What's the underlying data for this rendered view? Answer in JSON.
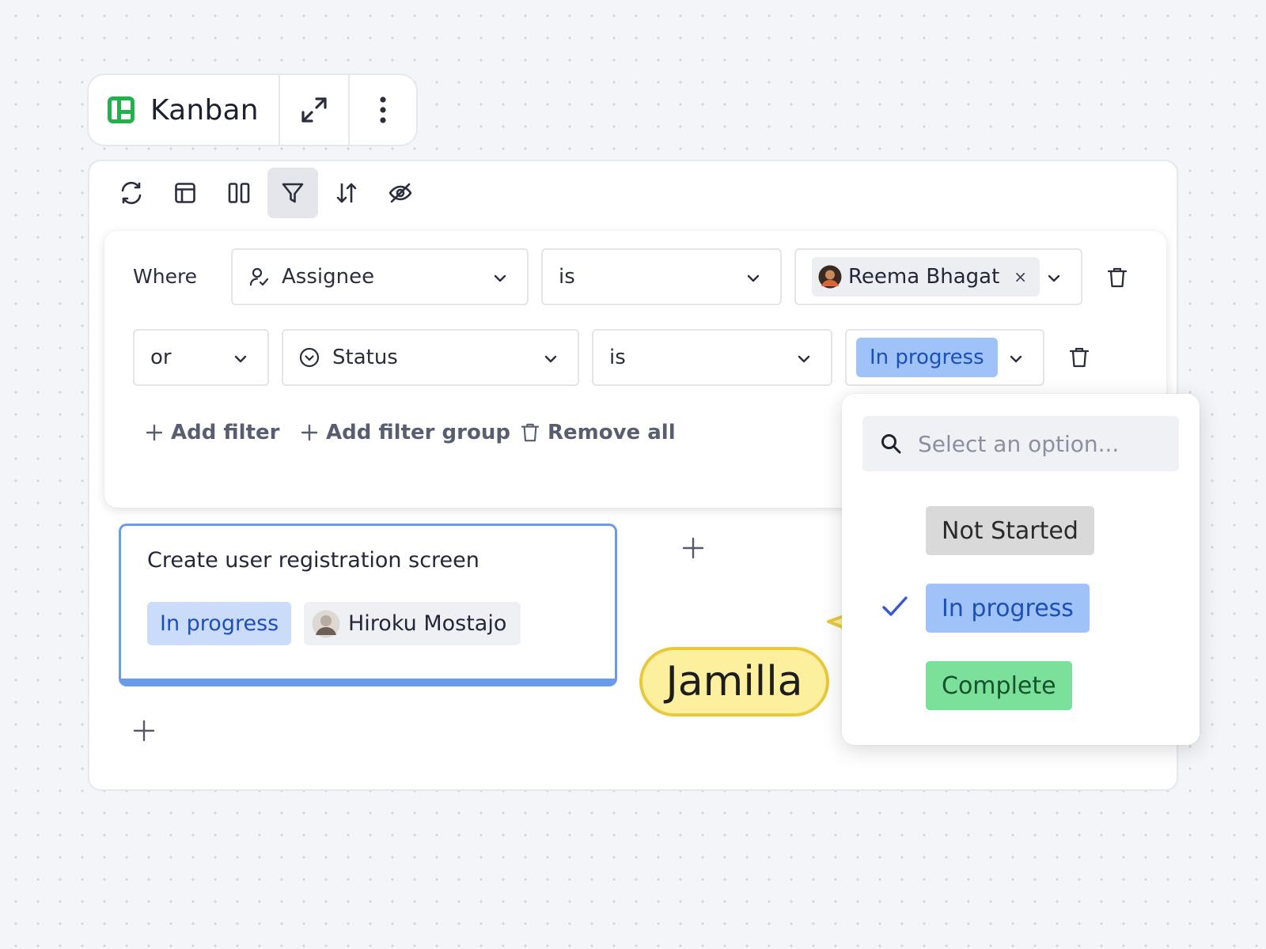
{
  "header": {
    "title": "Kanban",
    "icons": [
      "kanban-logo-icon",
      "expand-icon",
      "more-vertical-icon"
    ],
    "brand_color": "#22b14c"
  },
  "toolbar": {
    "buttons": [
      {
        "name": "refresh",
        "icon": "refresh-icon",
        "active": false
      },
      {
        "name": "layout",
        "icon": "layout-icon",
        "active": false
      },
      {
        "name": "columns",
        "icon": "columns-icon",
        "active": false
      },
      {
        "name": "filter",
        "icon": "filter-icon",
        "active": true
      },
      {
        "name": "sort",
        "icon": "sort-icon",
        "active": false
      },
      {
        "name": "hide",
        "icon": "eye-off-icon",
        "active": false
      }
    ]
  },
  "filters": {
    "row1": {
      "label": "Where",
      "field": "Assignee",
      "field_icon": "user-icon",
      "operator": "is",
      "value": "Reema Bhagat",
      "remove_symbol": "×"
    },
    "row2": {
      "conjunction": "or",
      "field": "Status",
      "field_icon": "status-circle-icon",
      "operator": "is",
      "value": "In progress"
    },
    "actions": {
      "add_filter": "Add filter",
      "add_filter_group": "Add filter group",
      "remove_all": "Remove all"
    }
  },
  "board": {
    "cards": [
      {
        "title": "Create user registration screen",
        "status": "In progress",
        "assignee": "Hiroku Mostajo"
      }
    ]
  },
  "collaborator": {
    "name": "Jamilla",
    "color": "#fcef9d"
  },
  "dropdown": {
    "search_placeholder": "Select an option...",
    "options": [
      {
        "label": "Not Started",
        "color": "#d9d9d9",
        "selected": false
      },
      {
        "label": "In progress",
        "color": "#9fc3f8",
        "selected": true
      },
      {
        "label": "Complete",
        "color": "#7be09a",
        "selected": false
      }
    ]
  },
  "colors": {
    "accent_blue": "#6b9be7",
    "check": "#3a55d6"
  }
}
